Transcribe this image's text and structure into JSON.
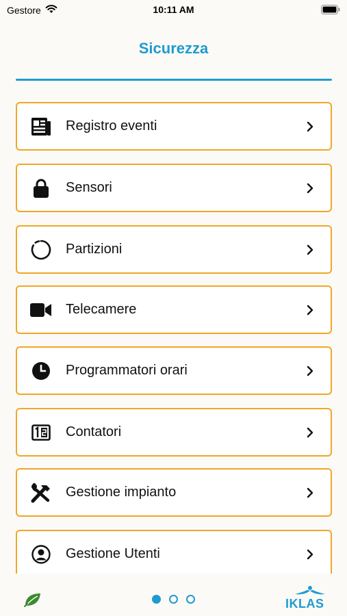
{
  "status_bar": {
    "carrier": "Gestore",
    "time": "10:11 AM"
  },
  "header": {
    "title": "Sicurezza",
    "accent_color": "#1f9bd1"
  },
  "menu": {
    "border_color": "#f0a726",
    "items": [
      {
        "label": "Registro eventi",
        "icon": "newspaper-icon"
      },
      {
        "label": "Sensori",
        "icon": "lock-icon"
      },
      {
        "label": "Partizioni",
        "icon": "partition-ring-icon"
      },
      {
        "label": "Telecamere",
        "icon": "video-camera-icon"
      },
      {
        "label": "Programmatori orari",
        "icon": "clock-icon"
      },
      {
        "label": "Contatori",
        "icon": "counter-icon"
      },
      {
        "label": "Gestione impianto",
        "icon": "tools-icon"
      },
      {
        "label": "Gestione Utenti",
        "icon": "user-circle-icon"
      }
    ]
  },
  "footer": {
    "pages": 3,
    "active_page": 1,
    "brand_name": "IKLAS"
  }
}
